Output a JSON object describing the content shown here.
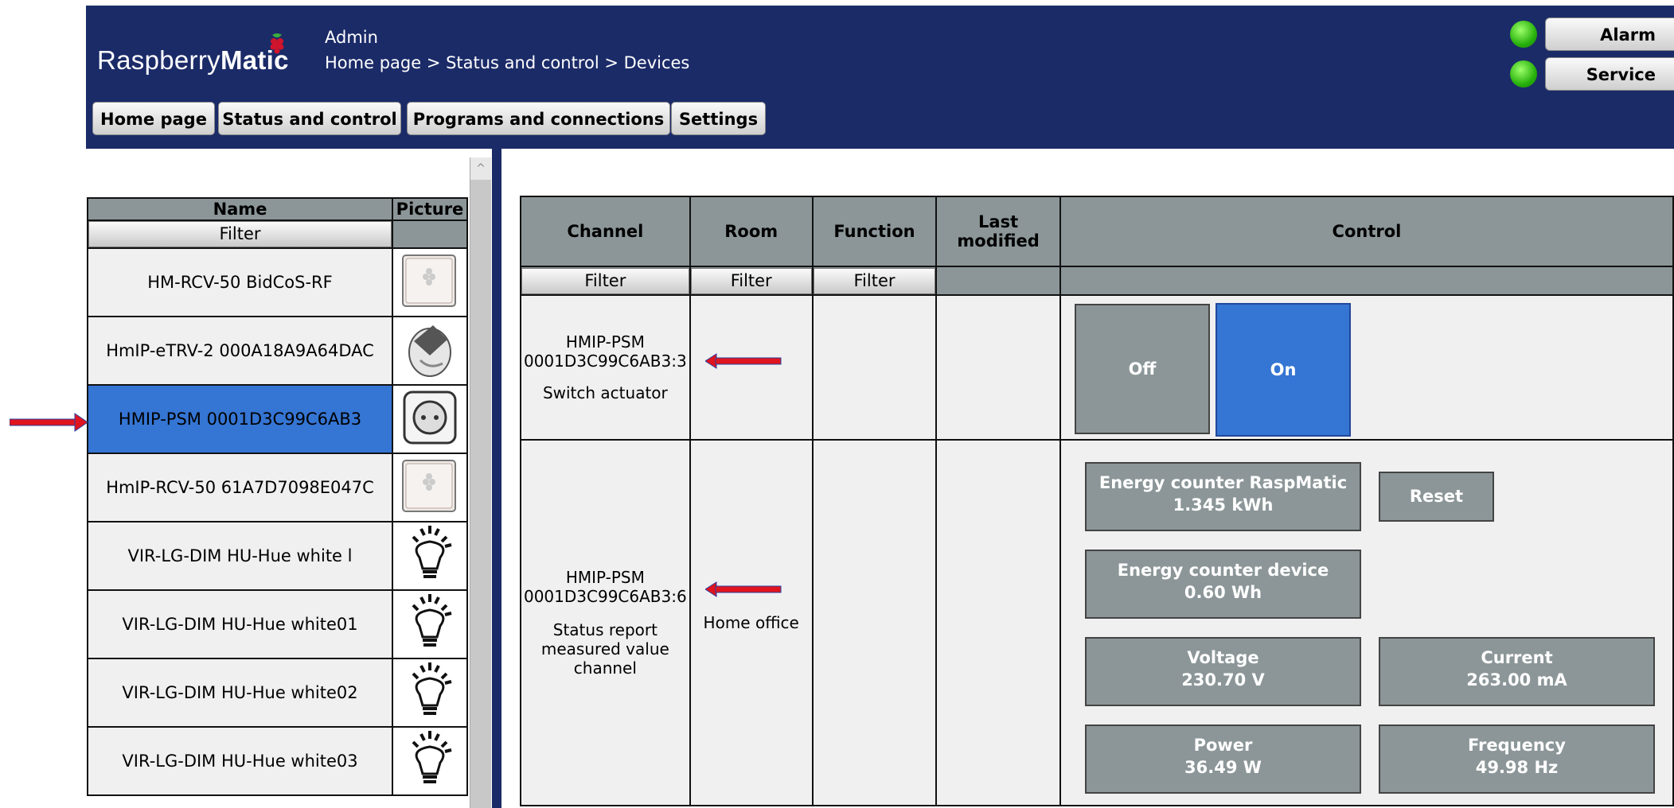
{
  "header": {
    "logo_light": "Raspberry",
    "logo_bold": "Matic",
    "user": "Admin",
    "breadcrumb": "Home page > Status and control > Devices",
    "nav": [
      "Home page",
      "Status and control",
      "Programs and connections",
      "Settings"
    ],
    "right_buttons": [
      "Alarm",
      "Service"
    ],
    "led_color": "#28b20c",
    "background_color": "#1b2b68"
  },
  "device_list": {
    "columns": [
      "Name",
      "Picture"
    ],
    "filter_label": "Filter",
    "selected_color": "#3575d3",
    "items": [
      {
        "name": "HM-RCV-50 BidCoS-RF",
        "icon": "ccu-device-icon"
      },
      {
        "name": "HmIP-eTRV-2 000A18A9A64DAC",
        "icon": "radiator-thermostat-icon"
      },
      {
        "name": "HMIP-PSM 0001D3C99C6AB3",
        "icon": "plug-socket-icon",
        "selected": true
      },
      {
        "name": "HmIP-RCV-50 61A7D7098E047C",
        "icon": "ccu-device-icon"
      },
      {
        "name": "VIR-LG-DIM HU-Hue white l",
        "icon": "light-bulb-icon"
      },
      {
        "name": "VIR-LG-DIM HU-Hue white01",
        "icon": "light-bulb-icon"
      },
      {
        "name": "VIR-LG-DIM HU-Hue white02",
        "icon": "light-bulb-icon"
      },
      {
        "name": "VIR-LG-DIM HU-Hue white03",
        "icon": "light-bulb-icon"
      }
    ]
  },
  "channel_table": {
    "columns": [
      "Channel",
      "Room",
      "Function",
      "Last modified",
      "Control"
    ],
    "filter_label": "Filter",
    "rows": [
      {
        "channel_line1": "HMIP-PSM",
        "channel_line2": "0001D3C99C6AB3:3",
        "channel_type": "Switch actuator",
        "room": "",
        "switch": {
          "off_label": "Off",
          "on_label": "On",
          "active": "On"
        }
      },
      {
        "channel_line1": "HMIP-PSM",
        "channel_line2": "0001D3C99C6AB3:6",
        "channel_type": "Status report measured value channel",
        "room": "Home office",
        "values": {
          "energy_rasp_label": "Energy counter RaspMatic",
          "energy_rasp_value": "1.345 kWh",
          "reset_label": "Reset",
          "energy_device_label": "Energy counter device",
          "energy_device_value": "0.60 Wh",
          "voltage_label": "Voltage",
          "voltage_value": "230.70 V",
          "current_label": "Current",
          "current_value": "263.00 mA",
          "power_label": "Power",
          "power_value": "36.49 W",
          "frequency_label": "Frequency",
          "frequency_value": "49.98 Hz"
        }
      }
    ]
  },
  "annotation_color": "#e0141e"
}
